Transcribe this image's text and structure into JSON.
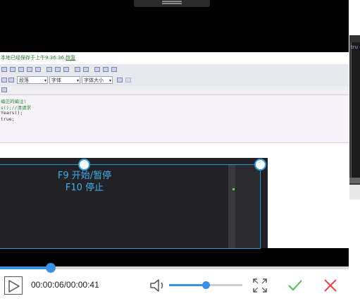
{
  "captured_editor": {
    "status_text": "本地已经保存于上午9:36:36,",
    "status_link": "恢复",
    "style_select": "段落",
    "font_select": "字体",
    "size_select": "字体大小",
    "code_lines": [
      "编正的编注)",
      "s();//清请求",
      "Years();",
      "true;"
    ]
  },
  "side_window": {
    "text": "tru"
  },
  "overlay": {
    "hint_f9": "F9 开始/暂停",
    "hint_f10": "F10 停止"
  },
  "playback": {
    "current_time": "00:00:06",
    "total_time": "00:00:41",
    "time_display": "00:00:06/00:00:41",
    "progress_fraction": 0.146,
    "volume_fraction": 0.5
  },
  "colors": {
    "accent": "#3a8ee6",
    "hint": "#3fb0ee",
    "confirm": "#4cc04c",
    "cancel": "#e04848"
  },
  "icons": {
    "play": "play-icon",
    "volume": "speaker-icon",
    "fullscreen": "expand-icon",
    "confirm": "check-icon",
    "cancel": "close-icon"
  }
}
